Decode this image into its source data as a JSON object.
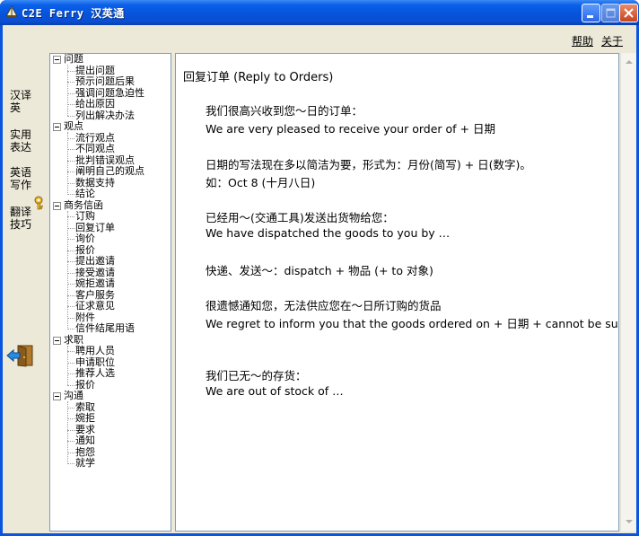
{
  "window": {
    "title": "C2E Ferry 汉英通"
  },
  "menu": {
    "help": "帮助",
    "about": "关于"
  },
  "leftnav": {
    "items": [
      {
        "line1": "汉译",
        "line2": "英"
      },
      {
        "line1": "实用",
        "line2": "表达"
      },
      {
        "line1": "英语",
        "line2": "写作"
      },
      {
        "line1": "翻译",
        "line2": "技巧"
      }
    ]
  },
  "tree": {
    "categories": [
      {
        "label": "问题",
        "children": [
          "提出问题",
          "预示问题后果",
          "强调问题急迫性",
          "给出原因",
          "列出解决办法"
        ]
      },
      {
        "label": "观点",
        "children": [
          "流行观点",
          "不同观点",
          "批判错误观点",
          "阐明自己的观点",
          "数据支持",
          "结论"
        ]
      },
      {
        "label": "商务信函",
        "children": [
          "订购",
          "回复订单",
          "询价",
          "报价",
          "提出邀请",
          "接受邀请",
          "婉拒邀请",
          "客户服务",
          "征求意见",
          "附件",
          "信件结尾用语"
        ]
      },
      {
        "label": "求职",
        "children": [
          "聘用人员",
          "申请职位",
          "推荐人选",
          "报价"
        ]
      },
      {
        "label": "沟通",
        "children": [
          "索取",
          "婉拒",
          "要求",
          "通知",
          "抱怨",
          "就学"
        ]
      }
    ]
  },
  "content": {
    "title": "回复订单 (Reply to Orders)",
    "lines": [
      "我们很高兴收到您～日的订单：",
      "We are very pleased to receive your order of + 日期",
      "日期的写法现在多以简洁为要，形式为：月份(简写) + 日(数字)。",
      "如：Oct 8 (十月八日)",
      "已经用～(交通工具)发送出货物给您：",
      "We have dispatched the goods to you by …",
      "快递、发送～：dispatch + 物品 (+ to 对象)",
      "很遗憾通知您，无法供应您在～日所订购的货品",
      "We regret to inform you that the goods ordered on + 日期  + cannot be supplied .",
      "我们已无～的存货：",
      "We are out of stock of …"
    ]
  },
  "icons": {
    "app": "ferry-logo-icon",
    "key": "key-icon",
    "exit": "exit-door-icon"
  },
  "colors": {
    "titlebar": "#0a54e0",
    "client_bg": "#ece9d8",
    "panel_border": "#7f9db9"
  }
}
